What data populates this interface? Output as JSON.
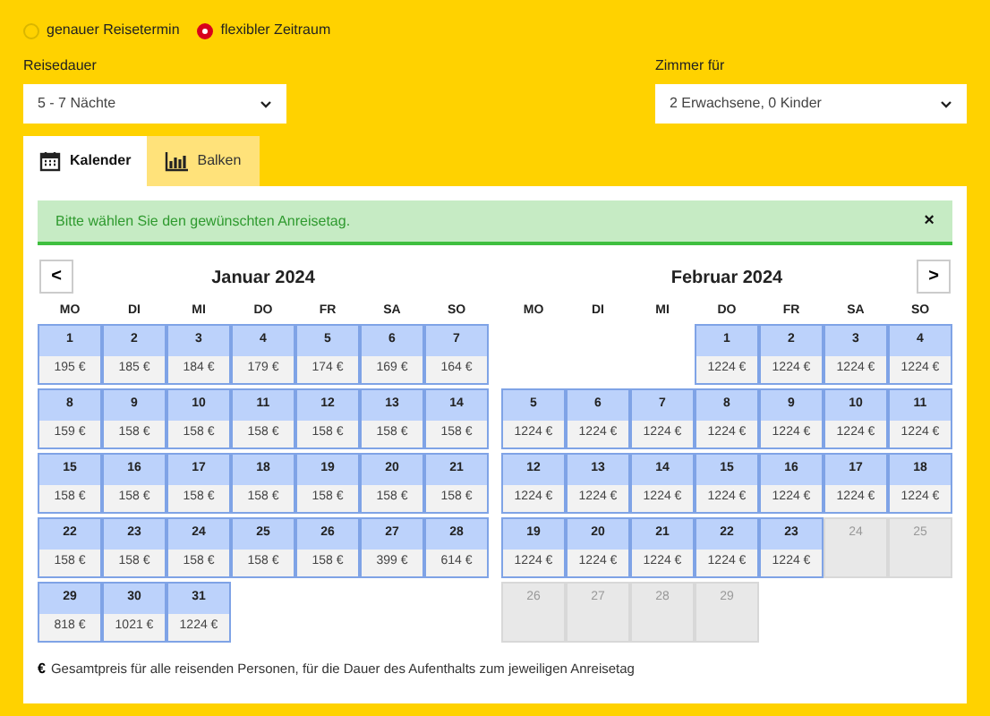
{
  "date_mode": [
    {
      "label": "genauer Reisetermin",
      "selected": false
    },
    {
      "label": "flexibler Zeitraum",
      "selected": true
    }
  ],
  "duration": {
    "label": "Reisedauer",
    "value": "5 - 7 Nächte"
  },
  "rooms": {
    "label": "Zimmer für",
    "value": "2 Erwachsene, 0 Kinder"
  },
  "tabs": [
    {
      "label": "Kalender",
      "kind": "calendar",
      "selected": true
    },
    {
      "label": "Balken",
      "kind": "bars",
      "selected": false
    }
  ],
  "alert": {
    "text": "Bitte wählen Sie den gewünschten Anreisetag.",
    "close": "×"
  },
  "nav": {
    "prev": "<",
    "next": ">"
  },
  "months": [
    {
      "title": "Januar 2024",
      "weekdays": [
        "MO",
        "DI",
        "MI",
        "DO",
        "FR",
        "SA",
        "SO"
      ],
      "weeks": [
        [
          {
            "kind": "available",
            "day": "1",
            "price": "195 €"
          },
          {
            "kind": "available",
            "day": "2",
            "price": "185 €"
          },
          {
            "kind": "available",
            "day": "3",
            "price": "184 €"
          },
          {
            "kind": "available",
            "day": "4",
            "price": "179 €"
          },
          {
            "kind": "available",
            "day": "5",
            "price": "174 €"
          },
          {
            "kind": "available",
            "day": "6",
            "price": "169 €"
          },
          {
            "kind": "available",
            "day": "7",
            "price": "164 €"
          }
        ],
        [
          {
            "kind": "available",
            "day": "8",
            "price": "159 €"
          },
          {
            "kind": "available",
            "day": "9",
            "price": "158 €"
          },
          {
            "kind": "available",
            "day": "10",
            "price": "158 €"
          },
          {
            "kind": "available",
            "day": "11",
            "price": "158 €"
          },
          {
            "kind": "available",
            "day": "12",
            "price": "158 €"
          },
          {
            "kind": "available",
            "day": "13",
            "price": "158 €"
          },
          {
            "kind": "available",
            "day": "14",
            "price": "158 €"
          }
        ],
        [
          {
            "kind": "available",
            "day": "15",
            "price": "158 €"
          },
          {
            "kind": "available",
            "day": "16",
            "price": "158 €"
          },
          {
            "kind": "available",
            "day": "17",
            "price": "158 €"
          },
          {
            "kind": "available",
            "day": "18",
            "price": "158 €"
          },
          {
            "kind": "available",
            "day": "19",
            "price": "158 €"
          },
          {
            "kind": "available",
            "day": "20",
            "price": "158 €"
          },
          {
            "kind": "available",
            "day": "21",
            "price": "158 €"
          }
        ],
        [
          {
            "kind": "available",
            "day": "22",
            "price": "158 €"
          },
          {
            "kind": "available",
            "day": "23",
            "price": "158 €"
          },
          {
            "kind": "available",
            "day": "24",
            "price": "158 €"
          },
          {
            "kind": "available",
            "day": "25",
            "price": "158 €"
          },
          {
            "kind": "available",
            "day": "26",
            "price": "158 €"
          },
          {
            "kind": "available",
            "day": "27",
            "price": "399 €"
          },
          {
            "kind": "available",
            "day": "28",
            "price": "614 €"
          }
        ],
        [
          {
            "kind": "available",
            "day": "29",
            "price": "818 €"
          },
          {
            "kind": "available",
            "day": "30",
            "price": "1021 €"
          },
          {
            "kind": "available",
            "day": "31",
            "price": "1224 €"
          }
        ]
      ]
    },
    {
      "title": "Februar 2024",
      "weekdays": [
        "MO",
        "DI",
        "MI",
        "DO",
        "FR",
        "SA",
        "SO"
      ],
      "weeks": [
        [
          {
            "kind": "empty"
          },
          {
            "kind": "empty"
          },
          {
            "kind": "empty"
          },
          {
            "kind": "available",
            "day": "1",
            "price": "1224 €"
          },
          {
            "kind": "available",
            "day": "2",
            "price": "1224 €"
          },
          {
            "kind": "available",
            "day": "3",
            "price": "1224 €"
          },
          {
            "kind": "available",
            "day": "4",
            "price": "1224 €"
          }
        ],
        [
          {
            "kind": "available",
            "day": "5",
            "price": "1224 €"
          },
          {
            "kind": "available",
            "day": "6",
            "price": "1224 €"
          },
          {
            "kind": "available",
            "day": "7",
            "price": "1224 €"
          },
          {
            "kind": "available",
            "day": "8",
            "price": "1224 €"
          },
          {
            "kind": "available",
            "day": "9",
            "price": "1224 €"
          },
          {
            "kind": "available",
            "day": "10",
            "price": "1224 €"
          },
          {
            "kind": "available",
            "day": "11",
            "price": "1224 €"
          }
        ],
        [
          {
            "kind": "available",
            "day": "12",
            "price": "1224 €"
          },
          {
            "kind": "available",
            "day": "13",
            "price": "1224 €"
          },
          {
            "kind": "available",
            "day": "14",
            "price": "1224 €"
          },
          {
            "kind": "available",
            "day": "15",
            "price": "1224 €"
          },
          {
            "kind": "available",
            "day": "16",
            "price": "1224 €"
          },
          {
            "kind": "available",
            "day": "17",
            "price": "1224 €"
          },
          {
            "kind": "available",
            "day": "18",
            "price": "1224 €"
          }
        ],
        [
          {
            "kind": "available",
            "day": "19",
            "price": "1224 €"
          },
          {
            "kind": "available",
            "day": "20",
            "price": "1224 €"
          },
          {
            "kind": "available",
            "day": "21",
            "price": "1224 €"
          },
          {
            "kind": "available",
            "day": "22",
            "price": "1224 €"
          },
          {
            "kind": "available",
            "day": "23",
            "price": "1224 €"
          },
          {
            "kind": "unavailable",
            "day": "24"
          },
          {
            "kind": "unavailable",
            "day": "25"
          }
        ],
        [
          {
            "kind": "unavailable",
            "day": "26"
          },
          {
            "kind": "unavailable",
            "day": "27"
          },
          {
            "kind": "unavailable",
            "day": "28"
          },
          {
            "kind": "unavailable",
            "day": "29"
          }
        ]
      ]
    }
  ],
  "footnote": {
    "symbol": "€",
    "text": "Gesamtpreis für alle reisenden Personen, für die Dauer des Aufenthalts zum jeweiligen Anreisetag"
  }
}
